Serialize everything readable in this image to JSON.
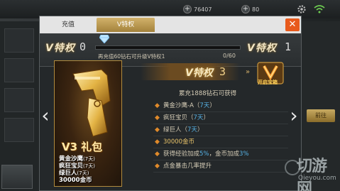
{
  "hud": {
    "coin_value": "76407",
    "diamond_value": "80"
  },
  "tabs": {
    "recharge": "充值",
    "vip": "V特权"
  },
  "vip_progress": {
    "current_badge": "V特权",
    "current_level": "0",
    "next_badge": "V特权",
    "next_level": "1",
    "hint": "再充值60钻石可升级V特权1",
    "value": "0/60",
    "fraction": 0
  },
  "pack": {
    "title": "V3 礼包",
    "items": [
      {
        "name": "黄金沙鹰",
        "duration": "(7天)"
      },
      {
        "name": "疯狂宝贝",
        "duration": "(7天)"
      },
      {
        "name": "绿巨人",
        "duration": "(7天)"
      },
      {
        "name": "30000金币",
        "duration": ""
      }
    ]
  },
  "detail": {
    "badge": "V特权",
    "level": "3",
    "arrow": "»",
    "upgrade_label": "开启宝箱",
    "heading": "累充1888钻石可获得",
    "benefits": [
      {
        "prefix": "黄金沙鹰-A（",
        "highlight": "7天",
        "suffix": "）"
      },
      {
        "prefix": "疯狂宝贝（",
        "highlight": "7天",
        "suffix": "）"
      },
      {
        "prefix": "绿巨人（",
        "highlight": "7天",
        "suffix": "）"
      },
      {
        "prefix": "",
        "highlight": "30000金币",
        "suffix": ""
      },
      {
        "prefix": "获得经验加成",
        "highlight": "5%",
        "suffix": "，金币加成",
        "highlight2": "3%"
      },
      {
        "prefix": "点金暴击几率提升",
        "highlight": "",
        "suffix": ""
      }
    ]
  },
  "background": {
    "right_button": "前往"
  },
  "watermark": {
    "main": "切游网",
    "sub": "Qieyou.com"
  },
  "colors": {
    "accent_gold": "#d2b26b",
    "close_red": "#e85a1c",
    "highlight_blue": "#57b3e6"
  }
}
